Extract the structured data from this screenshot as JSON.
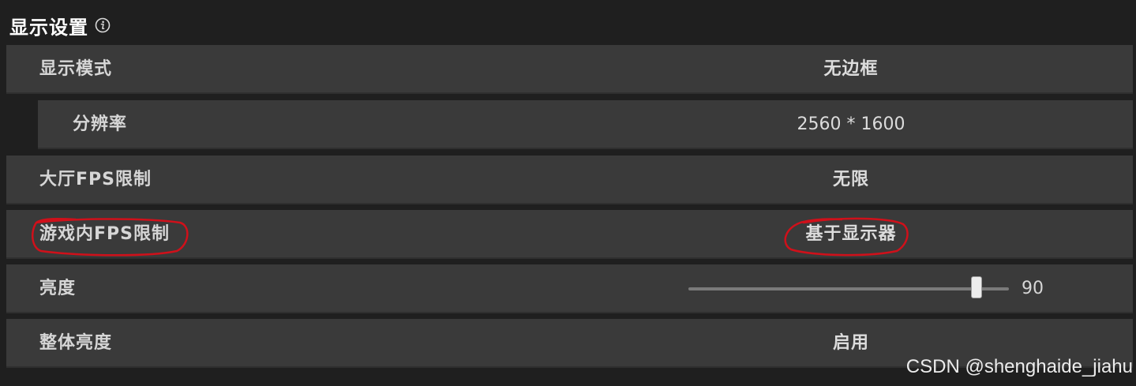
{
  "section": {
    "title": "显示设置",
    "info_icon": "info-icon"
  },
  "settings": [
    {
      "key": "display_mode",
      "label": "显示模式",
      "value": "无边框"
    },
    {
      "key": "resolution",
      "label": "分辨率",
      "value": "2560 * 1600"
    },
    {
      "key": "lobby_fps",
      "label": "大厅FPS限制",
      "value": "无限"
    },
    {
      "key": "ingame_fps",
      "label": "游戏内FPS限制",
      "value": "基于显示器"
    },
    {
      "key": "brightness",
      "label": "亮度",
      "value": "90",
      "slider_fraction": 0.9
    },
    {
      "key": "overall_brightness",
      "label": "整体亮度",
      "value": "启用"
    }
  ],
  "watermark": "CSDN @shenghaide_jiahu",
  "colors": {
    "background": "#1f1f1f",
    "row": "#3a3a3a",
    "annotation": "#d0101a"
  }
}
